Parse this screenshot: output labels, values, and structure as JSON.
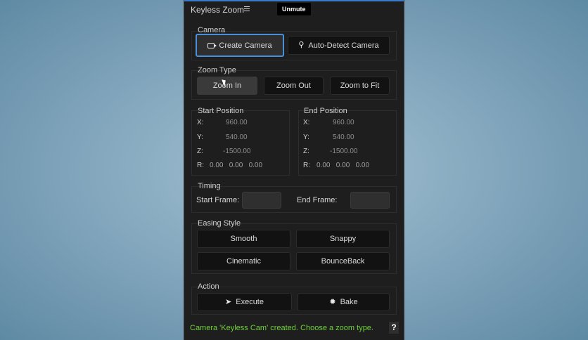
{
  "panel": {
    "title": "Keyless Zoom",
    "tooltip": "Unmute"
  },
  "camera": {
    "label": "Camera",
    "create_btn": "Create Camera",
    "detect_btn": "Auto-Detect Camera"
  },
  "zoom_type": {
    "label": "Zoom Type",
    "options": [
      "Zoom In",
      "Zoom Out",
      "Zoom to Fit"
    ],
    "selected": "Zoom In"
  },
  "start_position": {
    "label": "Start Position",
    "x_label": "X:",
    "x": "960.00",
    "y_label": "Y:",
    "y": "540.00",
    "z_label": "Z:",
    "z": "-1500.00",
    "r_label": "R:",
    "r": "0.00   0.00   0.00"
  },
  "end_position": {
    "label": "End Position",
    "x_label": "X:",
    "x": "960.00",
    "y_label": "Y:",
    "y": "540.00",
    "z_label": "Z:",
    "z": "-1500.00",
    "r_label": "R:",
    "r": "0.00   0.00   0.00"
  },
  "timing": {
    "label": "Timing",
    "start_frame_label": "Start Frame:",
    "start_frame_value": "",
    "end_frame_label": "End Frame:",
    "end_frame_value": ""
  },
  "easing": {
    "label": "Easing Style",
    "options": [
      "Smooth",
      "Snappy",
      "Cinematic",
      "BounceBack"
    ]
  },
  "action": {
    "label": "Action",
    "execute_btn": "Execute",
    "bake_btn": "Bake"
  },
  "status": {
    "message": "Camera 'Keyless Cam' created. Choose a zoom type.",
    "color": "#6fcf3b"
  },
  "help_label": "?",
  "colors": {
    "accent": "#4a8fd9",
    "panel_bg": "#1e1e1e"
  }
}
